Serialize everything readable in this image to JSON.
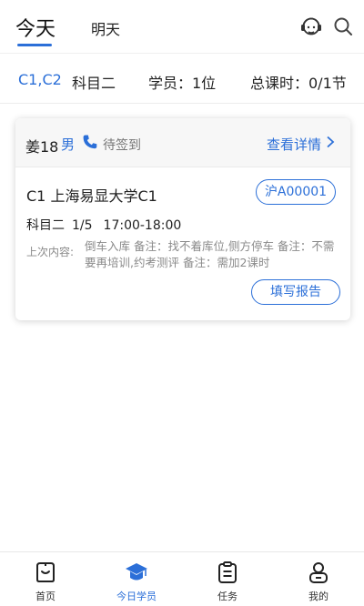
{
  "header": {
    "tabs": [
      {
        "label": "今天",
        "active": true
      },
      {
        "label": "明天",
        "active": false
      }
    ],
    "icons": [
      "headset-icon",
      "search-icon"
    ]
  },
  "summary": {
    "license": "C1,C2",
    "subject": "科目二",
    "students": "学员：1位",
    "hours": "总课时：0/1节"
  },
  "student_card": {
    "name": "姜18",
    "gender": "男",
    "status": "待签到",
    "detail_link": "查看详情",
    "school": "C1 上海易显大学C1",
    "plate": "沪A00001",
    "subject": "科目二",
    "progress": "1/5",
    "time": "17:00-18:00",
    "prev_label": "上次内容:",
    "prev_content": "倒车入库 备注：找不着库位,侧方停车 备注：不需要再培训,约考测评 备注：需加2课时",
    "report_button": "填写报告"
  },
  "tabbar": {
    "items": [
      {
        "label": "首页",
        "icon": "home-icon",
        "active": false
      },
      {
        "label": "今日学员",
        "icon": "graduation-cap-icon",
        "active": true
      },
      {
        "label": "任务",
        "icon": "clipboard-icon",
        "active": false
      },
      {
        "label": "我的",
        "icon": "user-icon",
        "active": false
      }
    ]
  },
  "colors": {
    "accent": "#2b6fd8",
    "muted_text": "#8a8a8a"
  }
}
